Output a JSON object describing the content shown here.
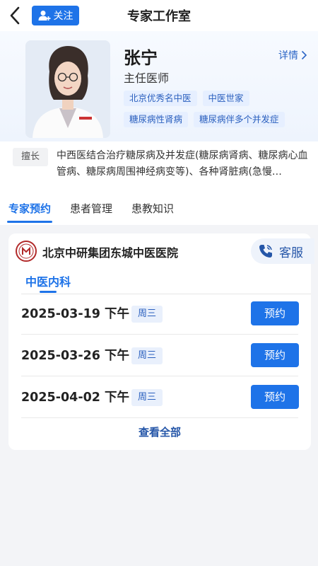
{
  "header": {
    "title": "专家工作室",
    "follow_label": "关注"
  },
  "doctor": {
    "name": "张宁",
    "title": "主任医师",
    "detail_label": "详情",
    "tags": [
      "北京优秀名中医",
      "中医世家",
      "糖尿病性肾病",
      "糖尿病伴多个并发症"
    ]
  },
  "specialty": {
    "label": "擅长",
    "text": "中西医结合治疗糖尿病及并发症(糖尿病肾病、糖尿病心血管病、糖尿病周围神经病变等)、各种肾脏病(急慢…"
  },
  "tabs": [
    {
      "label": "专家预约",
      "active": true
    },
    {
      "label": "患者管理",
      "active": false
    },
    {
      "label": "患教知识",
      "active": false
    }
  ],
  "hospital": {
    "name": "北京中研集团东城中医医院",
    "service_label": "客服",
    "department": "中医内科"
  },
  "slots": [
    {
      "date": "2025-03-19 下午",
      "weekday": "周三",
      "button": "预约"
    },
    {
      "date": "2025-03-26 下午",
      "weekday": "周三",
      "button": "预约"
    },
    {
      "date": "2025-04-02 下午",
      "weekday": "周三",
      "button": "预约"
    }
  ],
  "view_all_label": "查看全部",
  "colors": {
    "accent": "#1e73e8",
    "tag_bg": "#e6efff",
    "page_bg": "#f3f4f7"
  }
}
